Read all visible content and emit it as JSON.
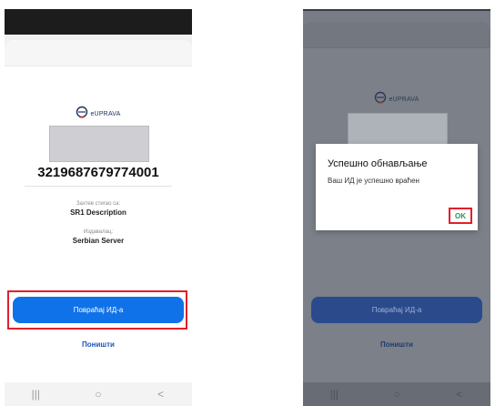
{
  "left": {
    "logo_text": "eUPRAVA",
    "id_number": "3219687679774001",
    "request_from_label": "Захтев стигао са:",
    "request_from_value": "SR1 Description",
    "issuer_label": "Издавалац:",
    "issuer_value": "Serbian Server",
    "primary_button": "Повраћај ИД-а",
    "cancel_link": "Поништи",
    "nav": {
      "recent": "|||",
      "home": "○",
      "back": "<"
    }
  },
  "right": {
    "logo_text": "eUPRAVA",
    "primary_button": "Повраћај ИД-а",
    "cancel_link": "Поништи",
    "nav": {
      "recent": "|||",
      "home": "○",
      "back": "<"
    },
    "dialog": {
      "title": "Успешно обнављање",
      "message": "Ваш ИД је успешно враћен",
      "ok_button": "OK"
    }
  },
  "colors": {
    "primary": "#1072e8",
    "highlight": "#e0202a",
    "ok_text": "#1e9a5a"
  },
  "icons": [
    "euprava-logo-icon",
    "recent-apps-icon",
    "home-icon",
    "back-icon"
  ]
}
